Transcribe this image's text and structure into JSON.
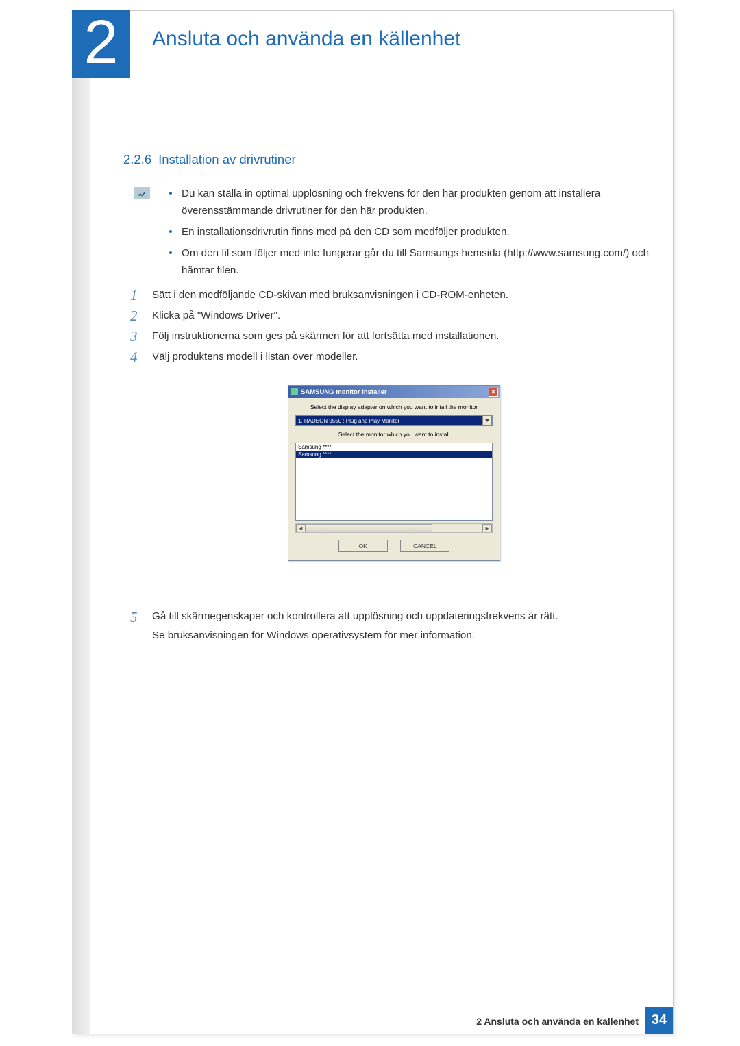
{
  "chapter": {
    "number": "2",
    "title": "Ansluta och använda en källenhet"
  },
  "section": {
    "number": "2.2.6",
    "title": "Installation av drivrutiner"
  },
  "notes": [
    "Du kan ställa in optimal upplösning och frekvens för den här produkten genom att installera överensstämmande drivrutiner för den här produkten.",
    "En installationsdrivrutin finns med på den CD som medföljer produkten.",
    "Om den fil som följer med inte fungerar går du till Samsungs hemsida (http://www.samsung.com/) och hämtar filen."
  ],
  "steps": {
    "1": "Sätt i den medföljande CD-skivan med bruksanvisningen i CD-ROM-enheten.",
    "2": "Klicka på \"Windows Driver\".",
    "3": "Följ instruktionerna som ges på skärmen för att fortsätta med installationen.",
    "4": "Välj produktens modell i listan över modeller.",
    "5a": "Gå till skärmegenskaper och kontrollera att upplösning och uppdateringsfrekvens är rätt.",
    "5b": "Se bruksanvisningen för Windows operativsystem för mer information."
  },
  "installer": {
    "title": "SAMSUNG monitor installer",
    "label1": "Select the display adapter on which you want to intall the monitor",
    "adapter": "1. RADEON 9550 : Plug and Play Monitor",
    "label2": "Select the monitor which you want to install",
    "list": [
      "Samsung ****",
      "Samsung ****"
    ],
    "ok": "OK",
    "cancel": "CANCEL"
  },
  "footer": {
    "text": "2 Ansluta och använda en källenhet",
    "page": "34"
  }
}
